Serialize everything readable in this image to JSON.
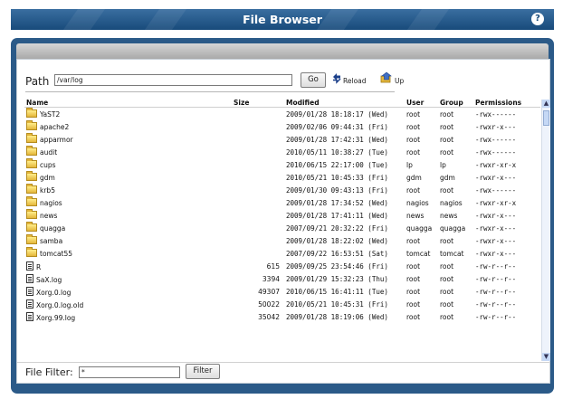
{
  "header": {
    "title": "File Browser",
    "help_icon": "help-icon"
  },
  "path": {
    "label": "Path",
    "value": "/var/log",
    "go_label": "Go",
    "reload_label": "Reload",
    "up_label": "Up"
  },
  "table": {
    "columns": {
      "name": "Name",
      "size": "Size",
      "modified": "Modified",
      "user": "User",
      "group": "Group",
      "permissions": "Permissions"
    },
    "rows": [
      {
        "type": "folder",
        "name": "YaST2",
        "size": "",
        "modified": "2009/01/28 18:18:17 (Wed)",
        "user": "root",
        "group": "root",
        "permissions": "-rwx------"
      },
      {
        "type": "folder",
        "name": "apache2",
        "size": "",
        "modified": "2009/02/06 09:44:31 (Fri)",
        "user": "root",
        "group": "root",
        "permissions": "-rwxr-x---"
      },
      {
        "type": "folder",
        "name": "apparmor",
        "size": "",
        "modified": "2009/01/28 17:42:31 (Wed)",
        "user": "root",
        "group": "root",
        "permissions": "-rwx------"
      },
      {
        "type": "folder",
        "name": "audit",
        "size": "",
        "modified": "2010/05/11 10:38:27 (Tue)",
        "user": "root",
        "group": "root",
        "permissions": "-rwx------"
      },
      {
        "type": "folder",
        "name": "cups",
        "size": "",
        "modified": "2010/06/15 22:17:00 (Tue)",
        "user": "lp",
        "group": "lp",
        "permissions": "-rwxr-xr-x"
      },
      {
        "type": "folder",
        "name": "gdm",
        "size": "",
        "modified": "2010/05/21 10:45:33 (Fri)",
        "user": "gdm",
        "group": "gdm",
        "permissions": "-rwxr-x---"
      },
      {
        "type": "folder",
        "name": "krb5",
        "size": "",
        "modified": "2009/01/30 09:43:13 (Fri)",
        "user": "root",
        "group": "root",
        "permissions": "-rwx------"
      },
      {
        "type": "folder",
        "name": "nagios",
        "size": "",
        "modified": "2009/01/28 17:34:52 (Wed)",
        "user": "nagios",
        "group": "nagios",
        "permissions": "-rwxr-xr-x"
      },
      {
        "type": "folder",
        "name": "news",
        "size": "",
        "modified": "2009/01/28 17:41:11 (Wed)",
        "user": "news",
        "group": "news",
        "permissions": "-rwxr-x---"
      },
      {
        "type": "folder",
        "name": "quagga",
        "size": "",
        "modified": "2007/09/21 20:32:22 (Fri)",
        "user": "quagga",
        "group": "quagga",
        "permissions": "-rwxr-x---"
      },
      {
        "type": "folder",
        "name": "samba",
        "size": "",
        "modified": "2009/01/28 18:22:02 (Wed)",
        "user": "root",
        "group": "root",
        "permissions": "-rwxr-x---"
      },
      {
        "type": "folder",
        "name": "tomcat55",
        "size": "",
        "modified": "2007/09/22 16:53:51 (Sat)",
        "user": "tomcat",
        "group": "tomcat",
        "permissions": "-rwxr-x---"
      },
      {
        "type": "file",
        "name": "R",
        "size": "615",
        "modified": "2009/09/25 23:54:46 (Fri)",
        "user": "root",
        "group": "root",
        "permissions": "-rw-r--r--"
      },
      {
        "type": "file",
        "name": "SaX.log",
        "size": "3394",
        "modified": "2009/01/29 15:32:23 (Thu)",
        "user": "root",
        "group": "root",
        "permissions": "-rw-r--r--"
      },
      {
        "type": "file",
        "name": "Xorg.0.log",
        "size": "49307",
        "modified": "2010/06/15 16:41:11 (Tue)",
        "user": "root",
        "group": "root",
        "permissions": "-rw-r--r--"
      },
      {
        "type": "file",
        "name": "Xorg.0.log.old",
        "size": "50022",
        "modified": "2010/05/21 10:45:31 (Fri)",
        "user": "root",
        "group": "root",
        "permissions": "-rw-r--r--"
      },
      {
        "type": "file",
        "name": "Xorg.99.log",
        "size": "35042",
        "modified": "2009/01/28 18:19:06 (Wed)",
        "user": "root",
        "group": "root",
        "permissions": "-rw-r--r--"
      }
    ]
  },
  "filter": {
    "label": "File Filter:",
    "value": "*",
    "button_label": "Filter"
  },
  "colors": {
    "titlebar": "#184b7b",
    "window_frame": "#2b5a88",
    "scrollbar": "#c5d8f5"
  }
}
